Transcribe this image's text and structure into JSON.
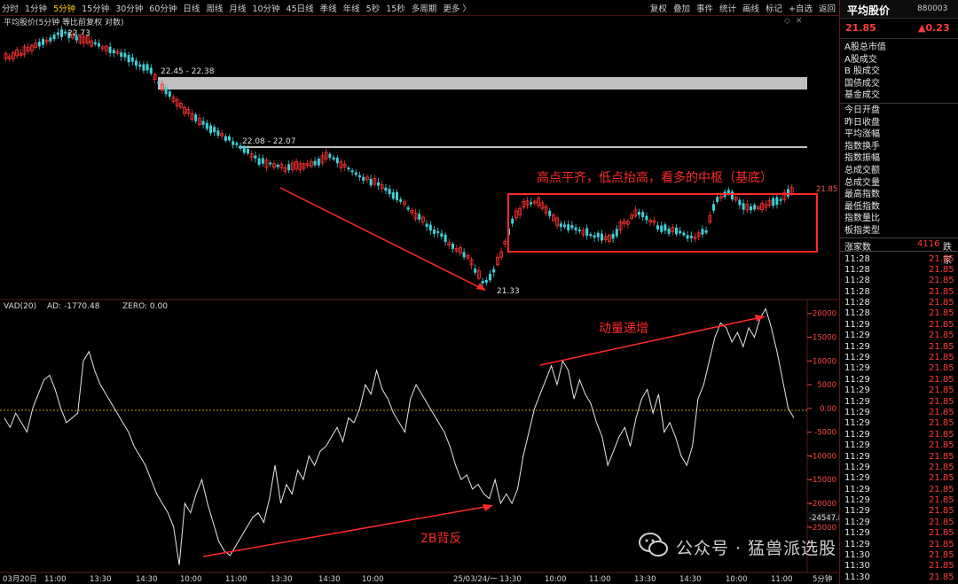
{
  "toolbar": {
    "periods": [
      "分时",
      "1分钟",
      "5分钟",
      "15分钟",
      "30分钟",
      "60分钟",
      "日线",
      "周线",
      "月线",
      "10分钟",
      "45日线",
      "季线",
      "年线",
      "5秒",
      "15秒",
      "多周期",
      "更多 〉"
    ],
    "active_period": "5分钟",
    "actions": [
      "复权",
      "叠加",
      "事件",
      "统计",
      "画线",
      "标记",
      "+自选",
      "返回"
    ]
  },
  "chart_title": "平均股价(5分钟 等比前复权 对数)",
  "chart_ctl_icons": [
    "settings-icon",
    "close-icon"
  ],
  "price_labels": {
    "high": "22.73",
    "low": "21.33",
    "band1": "22.45 - 22.38",
    "band2": "22.08 - 22.07",
    "current": "21.85"
  },
  "annotations": {
    "box_text": "高点平齐，低点抬高，看多的中枢（基底）",
    "momentum": "动量递增",
    "divergence": "2B背反"
  },
  "indicator": {
    "name": "VAD(20)",
    "ad_label": "AD: -1770.48",
    "zero_label": "ZERO: 0.00",
    "y_ticks": [
      "20000",
      "15000",
      "10000",
      "5000",
      "0.00",
      "-5000",
      "-10000",
      "-15000",
      "-20000",
      "-25000"
    ],
    "current_value": "-24547.8"
  },
  "x_axis": {
    "labels": [
      "03月20日",
      "11:00",
      "13:30",
      "14:30",
      "10:00",
      "11:00",
      "13:30",
      "14:30",
      "10:00",
      "25/03/24/一 13:30",
      "10:00",
      "11:00",
      "13:30",
      "14:30",
      "10:00",
      "11:00"
    ],
    "period_label": "5分钟"
  },
  "right_panel": {
    "title": "平均股价",
    "code": "880003",
    "price": "21.85",
    "change": "▲0.23",
    "labels_group1": [
      "A股总市值",
      " A股成交",
      " B 股成交",
      " 国债成交",
      " 基金成交"
    ],
    "labels_group2": [
      "今日开盘",
      "昨日收盘",
      "平均涨幅",
      "指数换手",
      "指数振幅",
      "总成交额",
      "总成交量",
      "最高指数",
      "最低指数",
      "指数量比",
      "板指类型"
    ],
    "rise_label": "涨家数",
    "rise_count": "4116",
    "fall_label": "跌家",
    "ticks": [
      {
        "t": "11:28",
        "v": "21.85"
      },
      {
        "t": "11:28",
        "v": "21.85"
      },
      {
        "t": "11:28",
        "v": "21.85"
      },
      {
        "t": "11:28",
        "v": "21.85"
      },
      {
        "t": "11:28",
        "v": "21.85"
      },
      {
        "t": "11:28",
        "v": "21.85"
      },
      {
        "t": "11:29",
        "v": "21.85"
      },
      {
        "t": "11:29",
        "v": "21.85"
      },
      {
        "t": "11:29",
        "v": "21.85"
      },
      {
        "t": "11:29",
        "v": "21.85"
      },
      {
        "t": "11:29",
        "v": "21.85"
      },
      {
        "t": "11:29",
        "v": "21.85"
      },
      {
        "t": "11:29",
        "v": "21.85"
      },
      {
        "t": "11:29",
        "v": "21.85"
      },
      {
        "t": "11:29",
        "v": "21.85"
      },
      {
        "t": "11:29",
        "v": "21.85"
      },
      {
        "t": "11:29",
        "v": "21.85"
      },
      {
        "t": "11:29",
        "v": "21.85"
      },
      {
        "t": "11:29",
        "v": "21.85"
      },
      {
        "t": "11:29",
        "v": "21.85"
      },
      {
        "t": "11:29",
        "v": "21.85"
      },
      {
        "t": "11:29",
        "v": "21.85"
      },
      {
        "t": "11:29",
        "v": "21.85"
      },
      {
        "t": "11:29",
        "v": "21.85"
      },
      {
        "t": "11:29",
        "v": "21.85"
      },
      {
        "t": "11:29",
        "v": "21.85"
      },
      {
        "t": "11:29",
        "v": "21.85"
      },
      {
        "t": "11:30",
        "v": "21.85"
      },
      {
        "t": "11:30",
        "v": "21.85"
      },
      {
        "t": "11:30",
        "v": "21.85"
      }
    ]
  },
  "watermark": "公众号 · 猛兽派选股",
  "colors": {
    "up": "#ff3333",
    "down": "#41d0d8",
    "annotation": "#ff2a2a",
    "zero_line": "#c8a000",
    "band": "#c0c0c0"
  },
  "chart_data": {
    "type": "line",
    "title": "VAD(20)",
    "series": [
      {
        "name": "VAD(20)",
        "y": [
          -2000,
          -4000,
          -1000,
          -3000,
          -5000,
          0,
          3000,
          6000,
          7000,
          4000,
          0,
          -3000,
          -2000,
          -1000,
          10000,
          12000,
          8000,
          5000,
          3000,
          1000,
          -1000,
          -3000,
          -5000,
          -8000,
          -10000,
          -12000,
          -15000,
          -18000,
          -20000,
          -22000,
          -25000,
          -33000,
          -20000,
          -22000,
          -18000,
          -15000,
          -20000,
          -24000,
          -28000,
          -30000,
          -31000,
          -29000,
          -27000,
          -25000,
          -23000,
          -22000,
          -24000,
          -19000,
          -12000,
          -20000,
          -16000,
          -18000,
          -13000,
          -15000,
          -10000,
          -12000,
          -9000,
          -8000,
          -6000,
          -4000,
          -7000,
          -2000,
          -3000,
          0,
          5000,
          3000,
          8000,
          4000,
          2000,
          -1000,
          -3000,
          -5000,
          2000,
          5000,
          3000,
          1000,
          -1000,
          -3000,
          -5000,
          -8000,
          -12000,
          -15000,
          -14000,
          -17000,
          -16000,
          -18000,
          -19000,
          -15000,
          -20000,
          -18000,
          -20000,
          -17000,
          -10000,
          -5000,
          0,
          3000,
          6000,
          9000,
          5000,
          10000,
          8000,
          2000,
          6000,
          3000,
          1000,
          -3000,
          -6000,
          -12000,
          -9000,
          -6000,
          -4000,
          -8000,
          -2000,
          2000,
          4000,
          -1000,
          3000,
          -5000,
          -3000,
          -6000,
          -10000,
          -12000,
          -8000,
          2000,
          5000,
          10000,
          15000,
          18000,
          17000,
          14000,
          16000,
          13000,
          17000,
          15000,
          19000,
          21000,
          17000,
          12000,
          6000,
          0,
          -2000
        ]
      }
    ],
    "ylim": [
      -34000,
      22000
    ],
    "grid": false
  }
}
